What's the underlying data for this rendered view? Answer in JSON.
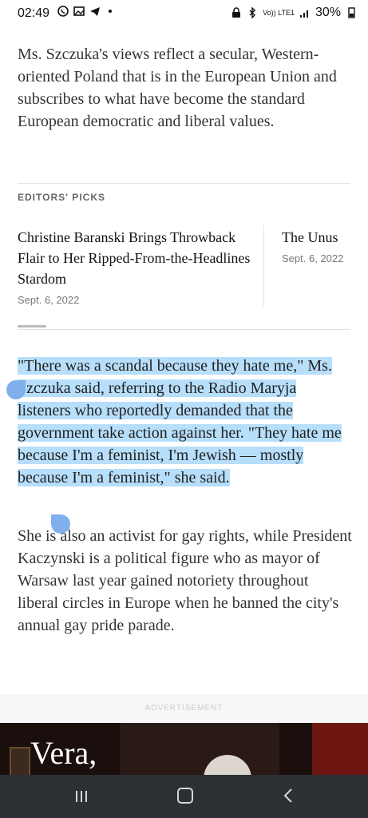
{
  "status_bar": {
    "time": "02:49",
    "battery": "30%",
    "network": "LTE",
    "volte": "Vo)) LTE1"
  },
  "article": {
    "paragraph1": "Ms. Szczuka's views reflect a secular, Western-oriented Poland that is in the European Union and subscribes to what have become the standard European democratic and liberal values.",
    "editors_picks_label": "EDITORS' PICKS",
    "picks": [
      {
        "title": "Christine Baranski Brings Throwback Flair to Her Ripped-From-the-Headlines Stardom",
        "date": "Sept. 6, 2022"
      },
      {
        "title": "The Unus",
        "date": "Sept. 6, 2022"
      }
    ],
    "quote_paragraph": "\"There was a scandal because they hate me,\" Ms. Szczuka said, referring to the Radio Maryja listeners who reportedly demanded that the government take action against her. \"They hate me because I'm a feminist, I'm Jewish — mostly because I'm a feminist,\" she said.",
    "paragraph3": "She is also an activist for gay rights, while President Kaczynski is a political figure who as mayor of Warsaw last year gained notoriety throughout liberal circles in Europe when he banned the city's annual gay pride parade.",
    "advertisement_label": "ADVERTISEMENT",
    "ad_title": "Vera,"
  },
  "colors": {
    "selection": "#b7defa",
    "selection_handle": "#7fb0ec",
    "nav_bar": "#2c2f34"
  },
  "icons": [
    "whatsapp-icon",
    "gallery-icon",
    "telegram-icon",
    "lock-icon",
    "bluetooth-icon",
    "signal-icon",
    "battery-icon",
    "recents-icon",
    "home-icon",
    "back-icon"
  ]
}
